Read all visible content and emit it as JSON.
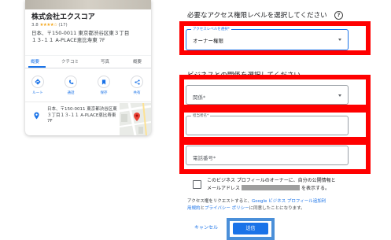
{
  "business_card": {
    "name": "株式会社エクスコア",
    "rating": "3.8",
    "stars": "★★★★☆",
    "review_count": "(17)",
    "address_line1": "日本、〒150-0011 東京都渋谷区東３丁目",
    "address_line2": "１３-１１ A-PLACE恵比寿東 7F",
    "tabs": [
      "概要",
      "クチコミ",
      "写真",
      "概要"
    ],
    "actions": [
      {
        "label": "ルート",
        "icon": "directions-icon"
      },
      {
        "label": "通話",
        "icon": "phone-icon"
      },
      {
        "label": "保存",
        "icon": "bookmark-icon"
      },
      {
        "label": "共有",
        "icon": "share-icon"
      }
    ],
    "detail_address": "日本、〒150-0011 東京都渋谷区東３丁目１３-１１ A-PLACE恵比寿東 7F"
  },
  "form": {
    "heading": "必要なアクセス権限レベルを選択してください",
    "help_glyph": "?",
    "access_select": {
      "floating_label": "アクセスレベルを選択*",
      "value": "オーナー権限"
    },
    "relation_section_title": "ビジネスとの関係を選択してください",
    "relation_select": {
      "placeholder": "関係*"
    },
    "name_field": {
      "floating_label": "担当者名*",
      "value": ""
    },
    "phone_field": {
      "placeholder": "電話番号*"
    },
    "consent_line1": "このビジネス プロフィールのオーナーに、自分の公開情報と",
    "consent_line2_pre": "メールアドレス",
    "consent_line2_post": "を表示する。",
    "terms_line1_pre": "アクセス権をリクエストすると、",
    "terms_line1_link": "Google ビジネス プロフィール追加利",
    "terms_line2_link1": "用規約",
    "terms_line2_mid": "と",
    "terms_line2_link2": "プライバシー ポリシー",
    "terms_line2_post": "に同意したことになります。",
    "cancel_label": "キャンセル",
    "submit_label": "送信"
  },
  "colors": {
    "accent": "#1a73e8",
    "highlight_red": "#ff0000",
    "highlight_blue": "#4a8fd9",
    "star": "#f4a921"
  }
}
